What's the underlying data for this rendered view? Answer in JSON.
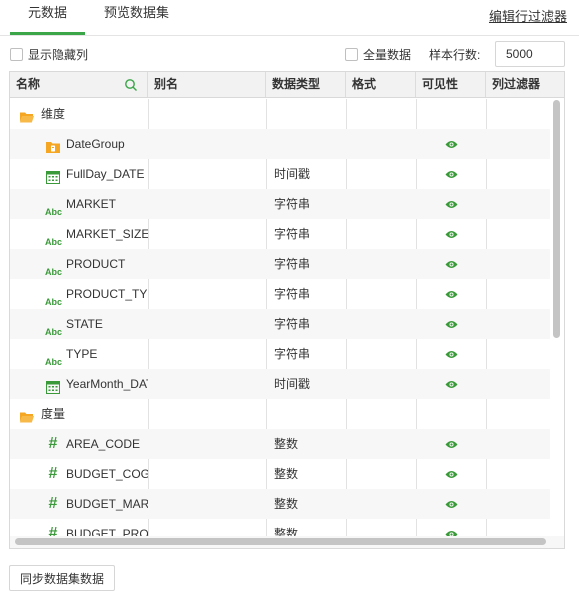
{
  "tabs": [
    {
      "label": "元数据",
      "active": true
    },
    {
      "label": "预览数据集",
      "active": false
    }
  ],
  "edit_row_filter_label": "编辑行过滤器",
  "show_hidden_columns_label": "显示隐藏列",
  "full_data_label": "全量数据",
  "sample_rows_label": "样本行数:",
  "sample_rows_value": "5000",
  "accent_color": "#3aa648",
  "table": {
    "headers": [
      "名称",
      "别名",
      "数据类型",
      "格式",
      "可见性",
      "列过滤器"
    ],
    "rows": [
      {
        "name": "维度",
        "icon": "folder-open-icon",
        "type": "",
        "visible": false,
        "level": 0
      },
      {
        "name": "DateGroup",
        "icon": "date-group-icon",
        "type": "",
        "visible": true,
        "level": 1
      },
      {
        "name": "FullDay_DATE",
        "icon": "calendar-icon",
        "type": "时间戳",
        "visible": true,
        "level": 1
      },
      {
        "name": "MARKET",
        "icon": "abc-icon",
        "type": "字符串",
        "visible": true,
        "level": 1
      },
      {
        "name": "MARKET_SIZE",
        "icon": "abc-icon",
        "type": "字符串",
        "visible": true,
        "level": 1
      },
      {
        "name": "PRODUCT",
        "icon": "abc-icon",
        "type": "字符串",
        "visible": true,
        "level": 1
      },
      {
        "name": "PRODUCT_TYPE",
        "icon": "abc-icon",
        "type": "字符串",
        "visible": true,
        "level": 1
      },
      {
        "name": "STATE",
        "icon": "abc-icon",
        "type": "字符串",
        "visible": true,
        "level": 1
      },
      {
        "name": "TYPE",
        "icon": "abc-icon",
        "type": "字符串",
        "visible": true,
        "level": 1
      },
      {
        "name": "YearMonth_DATE",
        "icon": "calendar-icon",
        "type": "时间戳",
        "visible": true,
        "level": 1
      },
      {
        "name": "度量",
        "icon": "folder-open-icon",
        "type": "",
        "visible": false,
        "level": 0
      },
      {
        "name": "AREA_CODE",
        "icon": "hash-icon",
        "type": "整数",
        "visible": true,
        "level": 1
      },
      {
        "name": "BUDGET_COGS",
        "icon": "hash-icon",
        "type": "整数",
        "visible": true,
        "level": 1
      },
      {
        "name": "BUDGET_MARGIN",
        "icon": "hash-icon",
        "type": "整数",
        "visible": true,
        "level": 1
      },
      {
        "name": "BUDGET_PROFIT",
        "icon": "hash-icon",
        "type": "整数",
        "visible": true,
        "level": 1
      }
    ]
  },
  "sync_button_label": "同步数据集数据"
}
